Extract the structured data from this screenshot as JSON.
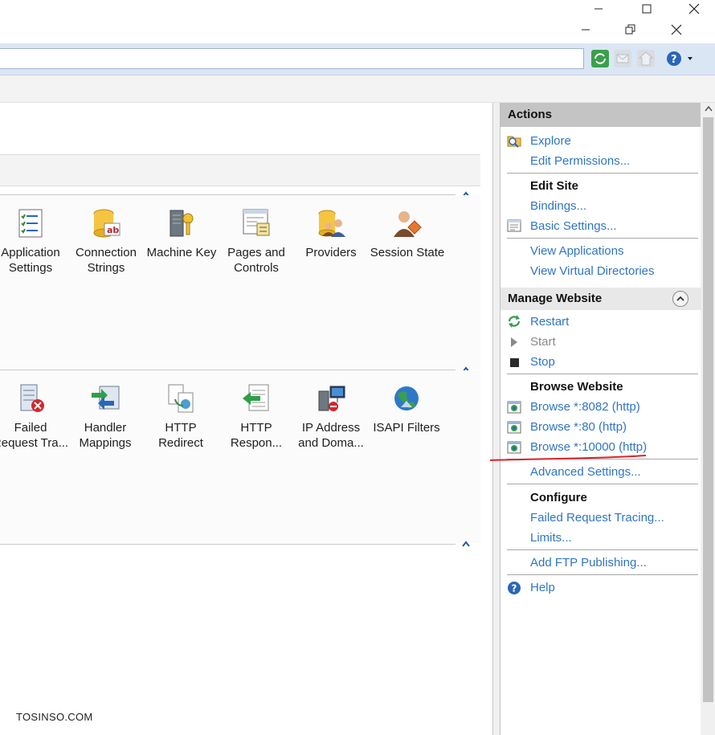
{
  "features_group1": [
    {
      "label1": "Application",
      "label2": "Settings",
      "icon": "application-settings-icon"
    },
    {
      "label1": "Connection",
      "label2": "Strings",
      "icon": "connection-strings-icon"
    },
    {
      "label1": "Machine Key",
      "label2": "",
      "icon": "machine-key-icon"
    },
    {
      "label1": "Pages and",
      "label2": "Controls",
      "icon": "pages-controls-icon"
    },
    {
      "label1": "Providers",
      "label2": "",
      "icon": "providers-icon"
    },
    {
      "label1": "Session State",
      "label2": "",
      "icon": "session-state-icon"
    }
  ],
  "features_group2": [
    {
      "label1": "Failed",
      "label2": "Request Tra...",
      "icon": "failed-request-icon"
    },
    {
      "label1": "Handler",
      "label2": "Mappings",
      "icon": "handler-mappings-icon"
    },
    {
      "label1": "HTTP",
      "label2": "Redirect",
      "icon": "http-redirect-icon"
    },
    {
      "label1": "HTTP",
      "label2": "Respon...",
      "icon": "http-response-icon"
    },
    {
      "label1": "IP Address",
      "label2": "and Doma...",
      "icon": "ip-address-icon"
    },
    {
      "label1": "ISAPI Filters",
      "label2": "",
      "icon": "isapi-filters-icon"
    }
  ],
  "actions": {
    "title": "Actions",
    "explore": "Explore",
    "edit_permissions": "Edit Permissions...",
    "edit_site": "Edit Site",
    "bindings": "Bindings...",
    "basic_settings": "Basic Settings...",
    "view_applications": "View Applications",
    "view_virtual_directories": "View Virtual Directories",
    "manage_website": "Manage Website",
    "restart": "Restart",
    "start": "Start",
    "stop": "Stop",
    "browse_website": "Browse Website",
    "browse_8082": "Browse *:8082 (http)",
    "browse_80": "Browse *:80 (http)",
    "browse_10000": "Browse *:10000 (http)",
    "advanced_settings": "Advanced Settings...",
    "configure": "Configure",
    "failed_request_tracing": "Failed Request Tracing...",
    "limits": "Limits...",
    "add_ftp_publishing": "Add FTP Publishing...",
    "help": "Help"
  },
  "watermark": "TOSINSO.COM",
  "colors": {
    "link": "#2f75c4",
    "annotation": "#d9232a",
    "header_gray": "#c4c4c4"
  }
}
